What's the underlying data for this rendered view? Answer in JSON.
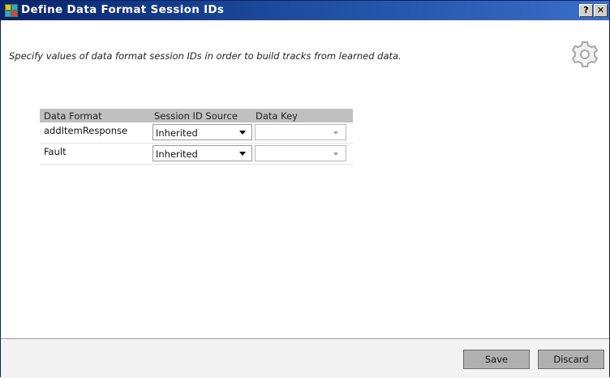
{
  "window": {
    "title": "Define Data Format Session IDs",
    "help_label": "?",
    "close_label": "✕"
  },
  "description": "Specify values of data format session IDs in order to build tracks from learned data.",
  "table": {
    "headers": [
      "Data Format",
      "Session ID Source",
      "Data Key"
    ],
    "rows": [
      {
        "data_format": "addItemResponse",
        "session_id_source": "Inherited",
        "data_key": ""
      },
      {
        "data_format": "Fault",
        "session_id_source": "Inherited",
        "data_key": ""
      }
    ]
  },
  "footer": {
    "save_label": "Save",
    "discard_label": "Discard"
  },
  "colors": {
    "titlebar_start": "#0a246a",
    "titlebar_end": "#3a6ec8",
    "header_bg": "#c0c0c0",
    "button_bg": "#b0b0b0"
  }
}
